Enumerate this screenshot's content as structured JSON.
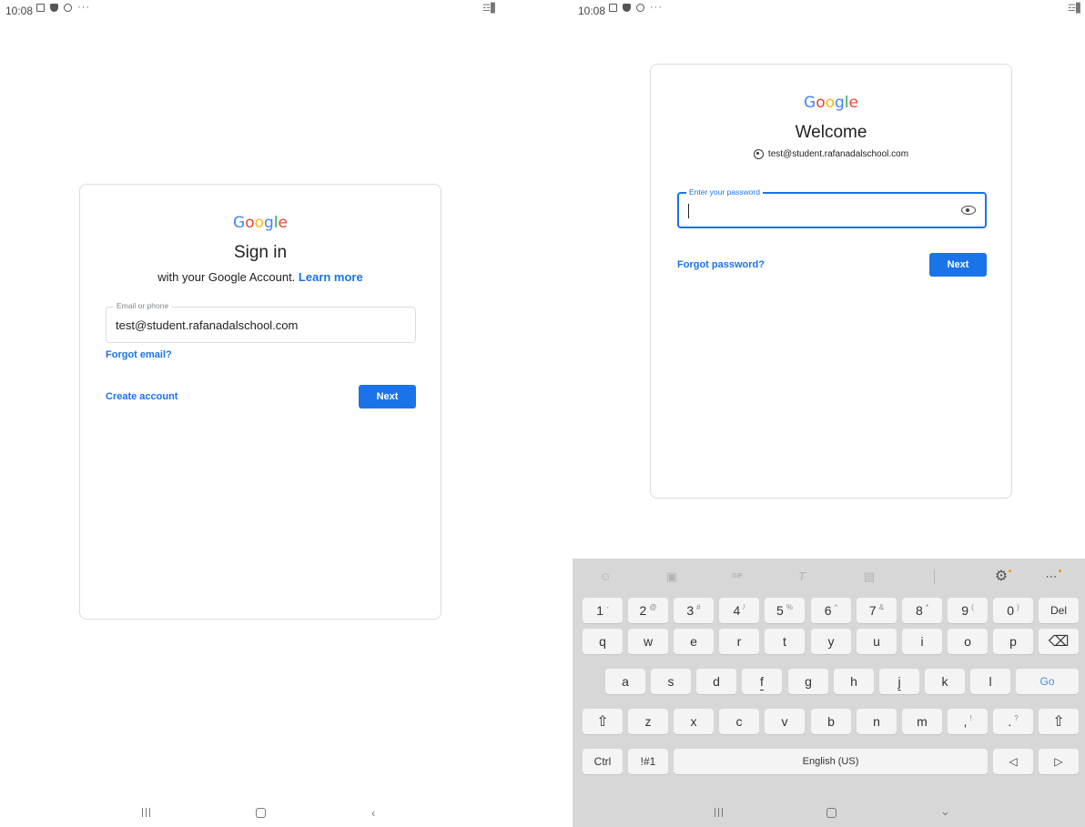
{
  "left_screen": {
    "status": {
      "time": "10:08",
      "more": "···",
      "right_icons": "☲▋"
    },
    "logo": [
      "G",
      "o",
      "o",
      "g",
      "l",
      "e"
    ],
    "title": "Sign in",
    "subtitle": "with your Google Account.",
    "learn_more": "Learn more",
    "field_label": "Email or phone",
    "field_value": "test@student.rafanadalschool.com",
    "forgot_email": "Forgot email?",
    "create_account": "Create account",
    "next": "Next",
    "nav_back": "‹"
  },
  "right_screen": {
    "status": {
      "time": "10:08",
      "more": "···",
      "right_icons": "☲▋"
    },
    "logo": [
      "G",
      "o",
      "o",
      "g",
      "l",
      "e"
    ],
    "title": "Welcome",
    "account": "test@student.rafanadalschool.com",
    "password_label": "Enter your password",
    "password_value": "",
    "forgot_password": "Forgot password?",
    "next": "Next",
    "nav_down": "⌄"
  },
  "keyboard": {
    "toolbar": [
      {
        "name": "emoji-icon",
        "glyph": "☺"
      },
      {
        "name": "sticker-icon",
        "glyph": "▣"
      },
      {
        "name": "gif-icon",
        "glyph": "GIF"
      },
      {
        "name": "text-style-icon",
        "glyph": "T"
      },
      {
        "name": "clipboard-icon",
        "glyph": "▤"
      },
      {
        "name": "microphone-icon",
        "glyph": "│"
      },
      {
        "name": "settings-icon",
        "glyph": "⚙"
      },
      {
        "name": "more-icon",
        "glyph": "⋯"
      }
    ],
    "row1": [
      {
        "label": "1",
        "alt": "-"
      },
      {
        "label": "2",
        "alt": "@"
      },
      {
        "label": "3",
        "alt": "#"
      },
      {
        "label": "4",
        "alt": "/"
      },
      {
        "label": "5",
        "alt": "%"
      },
      {
        "label": "6",
        "alt": "^"
      },
      {
        "label": "7",
        "alt": "&"
      },
      {
        "label": "8",
        "alt": "*"
      },
      {
        "label": "9",
        "alt": "("
      },
      {
        "label": "0",
        "alt": ")"
      },
      {
        "label": "Del",
        "alt": ""
      }
    ],
    "row2": [
      "q",
      "w",
      "e",
      "r",
      "t",
      "y",
      "u",
      "i",
      "o",
      "p",
      "⌫"
    ],
    "row3": [
      "a",
      "s",
      "d",
      "f",
      "g",
      "h",
      "j",
      "k",
      "l",
      "Go"
    ],
    "row4": [
      {
        "label": "⇧",
        "alt": ""
      },
      {
        "label": "z",
        "alt": ""
      },
      {
        "label": "x",
        "alt": ""
      },
      {
        "label": "c",
        "alt": ""
      },
      {
        "label": "v",
        "alt": ""
      },
      {
        "label": "b",
        "alt": ""
      },
      {
        "label": "n",
        "alt": ""
      },
      {
        "label": "m",
        "alt": ""
      },
      {
        "label": ",",
        "alt": "!"
      },
      {
        "label": ".",
        "alt": "?"
      },
      {
        "label": "⇧",
        "alt": ""
      }
    ],
    "row5": [
      "Ctrl",
      "!#1",
      "English (US)",
      "◁",
      "▷"
    ]
  },
  "colors": {
    "accent": "#1a73e8",
    "google_blue": "#4285f4",
    "google_red": "#ea4335",
    "google_yellow": "#fbbc05",
    "google_green": "#34a853",
    "keyboard_bg": "#d7d7d7"
  }
}
